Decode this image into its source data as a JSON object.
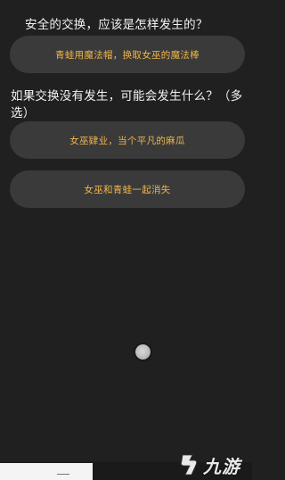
{
  "quiz": {
    "question1": "安全的交换，应该是怎样发生的？",
    "option1": "青蛙用魔法帽，换取女巫的魔法棒",
    "question2": "如果交换没有发生，可能会发生什么？（多选）",
    "option2": "女巫肄业，当个平凡的麻瓜",
    "option3": "女巫和青蛙一起消失"
  },
  "watermark": {
    "text": "九游",
    "icon": "jiuyou-logo-icon"
  },
  "colors": {
    "background": "#202020",
    "option_bg": "#3a3a3a",
    "option_text": "#f0b54a",
    "question_text": "#f2f2f2"
  }
}
